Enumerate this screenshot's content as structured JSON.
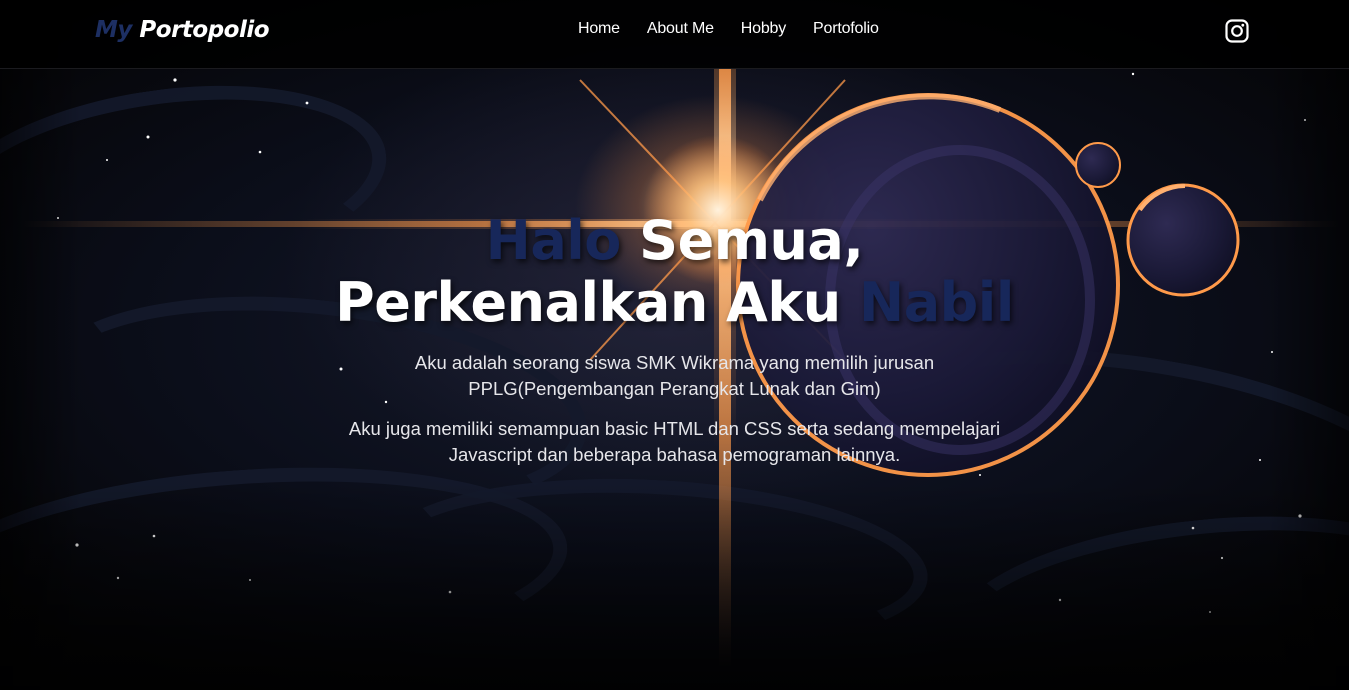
{
  "navbar": {
    "brand_prefix": "My",
    "brand_name": "Portopolio",
    "links": [
      {
        "label": "Home"
      },
      {
        "label": "About Me"
      },
      {
        "label": "Hobby"
      },
      {
        "label": "Portofolio"
      }
    ],
    "social_icon": "instagram-icon"
  },
  "hero": {
    "line1_highlight": "Halo",
    "line1_rest": " Semua,",
    "line2_rest": "Perkenalkan Aku ",
    "line2_highlight": "Nabil",
    "paragraph1": "Aku adalah seorang siswa SMK Wikrama yang memilih jurusan PPLG(Pengembangan Perangkat Lunak dan Gim)",
    "paragraph2": "Aku juga memiliki semampuan basic HTML dan CSS serta sedang mempelajari Javascript dan beberapa bahasa pemograman lainnya."
  },
  "colors": {
    "brand_accent": "#1d2f63",
    "highlight_text": "#17275a",
    "navbar_bg": "#000000",
    "text": "#ffffff",
    "glow": "#ff9a4a"
  }
}
